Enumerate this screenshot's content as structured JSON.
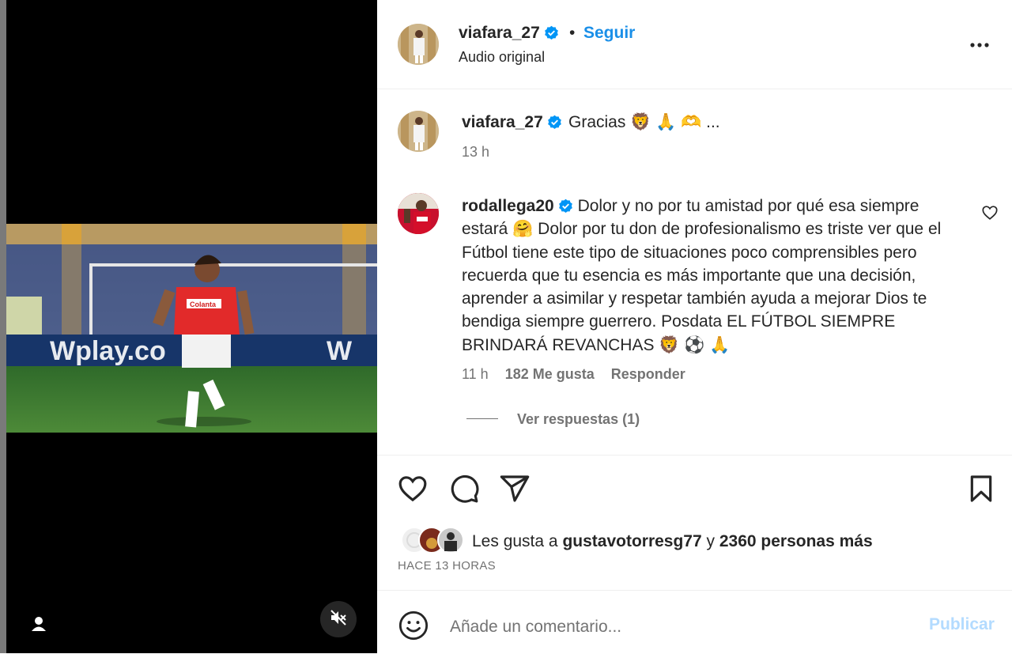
{
  "post": {
    "username": "viafara_27",
    "separator": "•",
    "follow_label": "Seguir",
    "audio_label": "Audio original"
  },
  "caption": {
    "username": "viafara_27",
    "text": "Gracias 🦁 🙏 🫶 ...",
    "time": "13 h"
  },
  "comment": {
    "username": "rodallega20",
    "text": "Dolor y no por tu amistad por qué esa siempre estará 🤗 Dolor por tu don de profesionalismo es triste ver que el Fútbol tiene este tipo de situaciones poco comprensibles pero recuerda que tu esencia es más importante que una decisión, aprender a asimilar y respetar también ayuda a mejorar Dios te bendiga siempre guerrero. Posdata EL FÚTBOL SIEMPRE BRINDARÁ REVANCHAS 🦁 ⚽ 🙏",
    "time": "11 h",
    "likes": "182 Me gusta",
    "reply_label": "Responder",
    "view_replies": "Ver respuestas (1)"
  },
  "likes": {
    "prefix": "Les gusta a",
    "user": "gustavotorresg77",
    "joiner": "y",
    "others": "2360 personas más"
  },
  "timestamp": "HACE 13 HORAS",
  "composer": {
    "placeholder": "Añade un comentario...",
    "publish_label": "Publicar"
  },
  "media": {
    "banner_text": "Wplay.co",
    "shirt_text": "Colanta"
  },
  "colors": {
    "accent": "#0095f6",
    "publish_disabled": "#b3dbff",
    "muted_text": "#737373",
    "verified": "#0095f6"
  }
}
